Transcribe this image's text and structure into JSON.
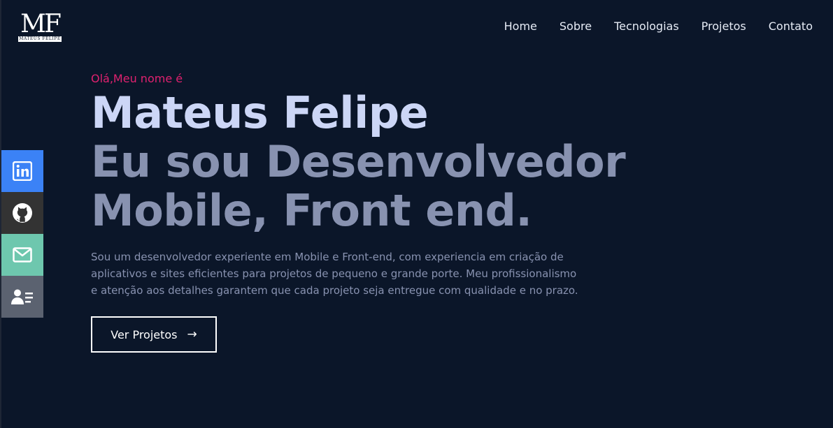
{
  "logo": {
    "mark": "MF",
    "subtitle": "MATEUS FELIPE"
  },
  "nav": {
    "home": "Home",
    "sobre": "Sobre",
    "tecnologias": "Tecnologias",
    "projetos": "Projetos",
    "contato": "Contato"
  },
  "social": {
    "icons": [
      "linkedin-icon",
      "github-icon",
      "mail-icon",
      "contact-card-icon"
    ],
    "colors": {
      "linkedin": "#3b82f6",
      "github": "#333333",
      "mail": "#6ec7ae",
      "contact": "#5b6270"
    }
  },
  "hero": {
    "greeting": "Olá,Meu nome é",
    "name": "Mateus Felipe",
    "role_line1": "Eu sou Desenvolvedor",
    "role_line2": "Mobile, Front end.",
    "description": "Sou um desenvolvedor experiente em Mobile e Front-end, com experiencia em criação de aplicativos e sites eficientes para projetos de pequeno e grande porte. Meu profissionalismo e atenção aos detalhes garantem que cada projeto seja entregue com qualidade e no prazo.",
    "cta_label": "Ver Projetos",
    "cta_arrow": "→"
  },
  "colors": {
    "background": "#0b1629",
    "accent": "#e0216f",
    "name": "#ccd6f6",
    "muted": "#8892b0"
  }
}
